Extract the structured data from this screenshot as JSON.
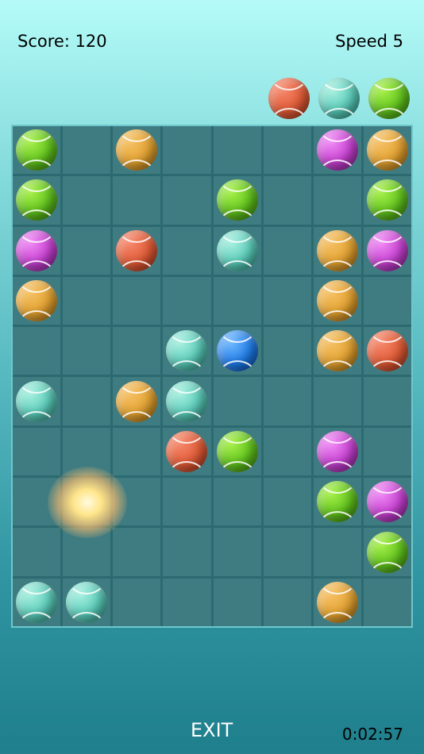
{
  "hud": {
    "score_text": "Score:  120",
    "speed_text": "Speed 5"
  },
  "next_balls": [
    "red",
    "teal",
    "green"
  ],
  "board": {
    "rows": 10,
    "cols": 8,
    "cells": [
      [
        "green",
        "",
        "orange",
        "",
        "",
        "",
        "purple",
        "orange"
      ],
      [
        "green",
        "",
        "",
        "",
        "green",
        "",
        "",
        "green"
      ],
      [
        "purple",
        "",
        "red",
        "",
        "teal",
        "",
        "orange",
        "purple"
      ],
      [
        "orange",
        "",
        "",
        "",
        "",
        "",
        "orange",
        ""
      ],
      [
        "",
        "",
        "",
        "teal",
        "blue",
        "",
        "orange",
        "red"
      ],
      [
        "teal",
        "",
        "orange",
        "teal",
        "",
        "",
        "",
        ""
      ],
      [
        "",
        "",
        "",
        "red",
        "green",
        "",
        "purple",
        ""
      ],
      [
        "",
        "",
        "",
        "",
        "",
        "",
        "green",
        "purple"
      ],
      [
        "",
        "",
        "",
        "",
        "",
        "",
        "",
        "green"
      ],
      [
        "teal",
        "teal",
        "",
        "",
        "",
        "",
        "orange",
        ""
      ]
    ]
  },
  "footer": {
    "exit_label": "EXIT",
    "timer": "0:02:57"
  },
  "colors": {
    "green": "#5fc21c",
    "orange": "#e3a230",
    "purple": "#c53fd0",
    "teal": "#58cab8",
    "red": "#e05a35",
    "blue": "#1e7ae6"
  }
}
